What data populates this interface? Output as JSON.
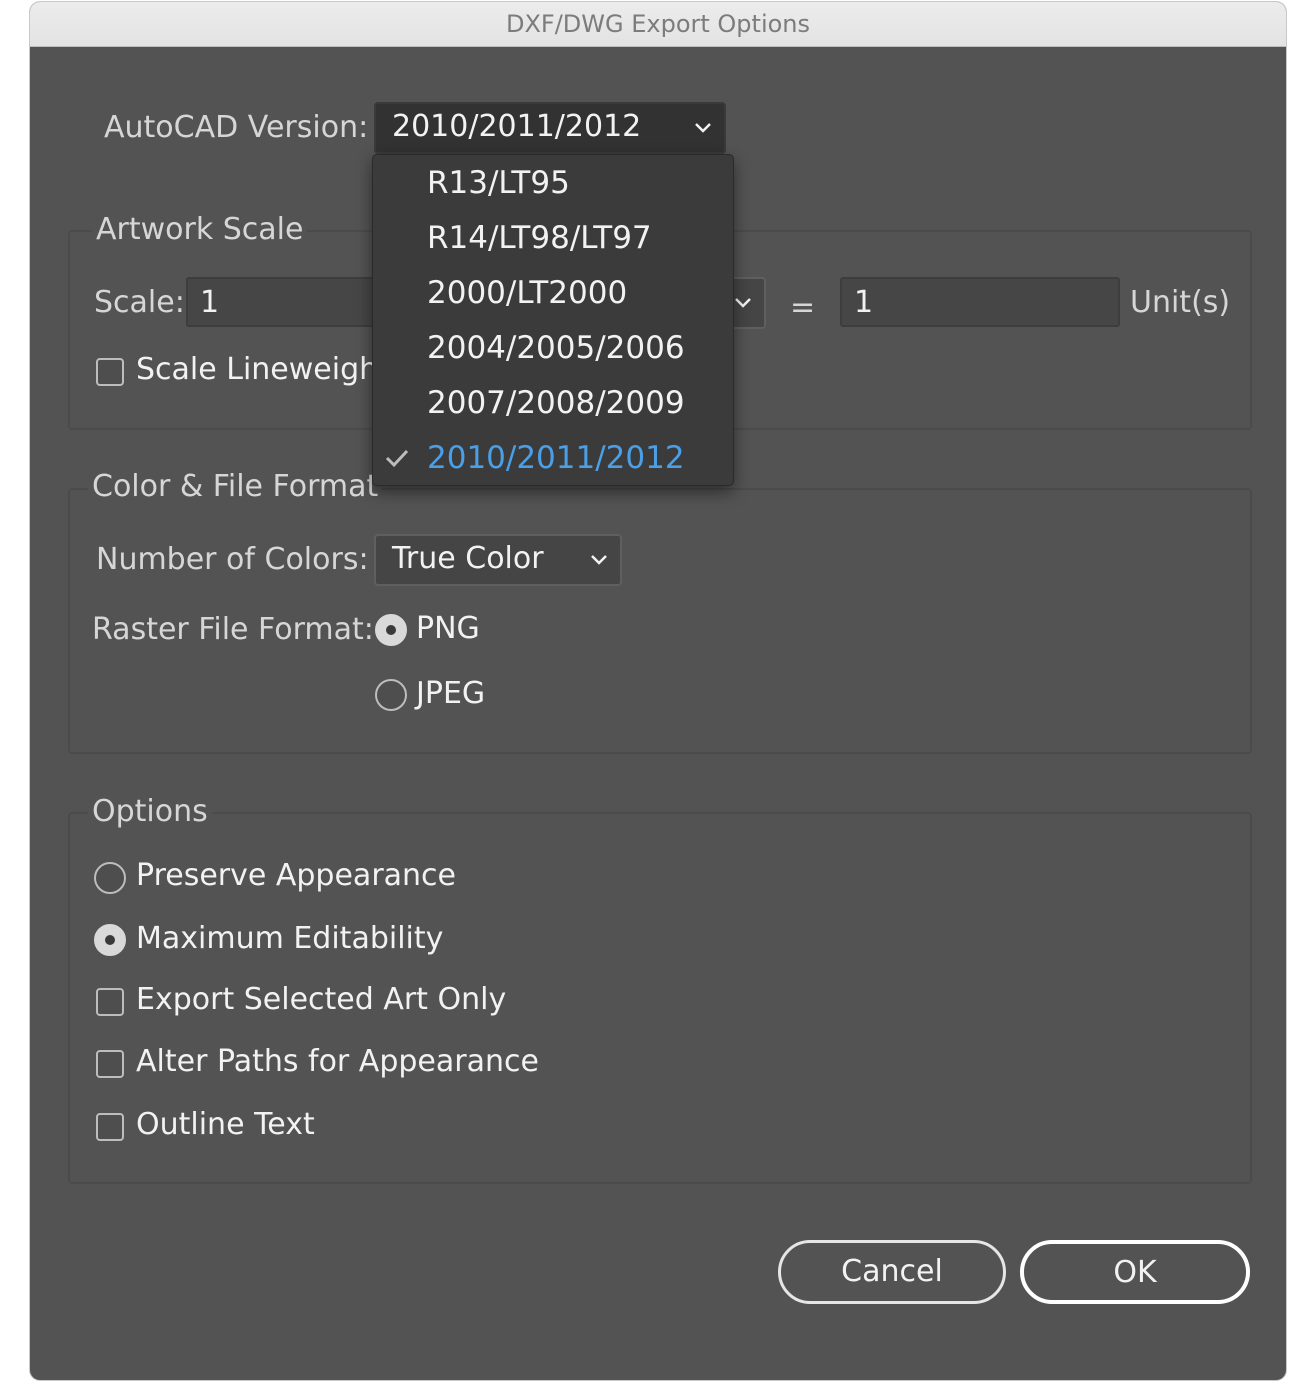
{
  "window": {
    "title": "DXF/DWG Export Options"
  },
  "autocad": {
    "label": "AutoCAD Version:",
    "selected": "2010/2011/2012",
    "options": [
      "R13/LT95",
      "R14/LT98/LT97",
      "2000/LT2000",
      "2004/2005/2006",
      "2007/2008/2009",
      "2010/2011/2012"
    ],
    "checked_index": 5
  },
  "artwork_scale": {
    "title": "Artwork Scale",
    "scale_label": "Scale:",
    "scale_value": "1",
    "equals": "=",
    "units_value": "1",
    "units_label": "Unit(s)",
    "scale_lineweights_label": "Scale Lineweight"
  },
  "color_file": {
    "title": "Color & File Format",
    "colors_label": "Number of Colors:",
    "colors_value": "True Color",
    "raster_label": "Raster File Format:",
    "png_label": "PNG",
    "jpeg_label": "JPEG"
  },
  "options": {
    "title": "Options",
    "preserve_label": "Preserve Appearance",
    "max_edit_label": "Maximum Editability",
    "export_selected_label": "Export Selected Art Only",
    "alter_paths_label": "Alter Paths for Appearance",
    "outline_text_label": "Outline Text"
  },
  "buttons": {
    "cancel": "Cancel",
    "ok": "OK"
  },
  "colors": {
    "highlight": "#4a9fe6",
    "background": "#535353"
  }
}
